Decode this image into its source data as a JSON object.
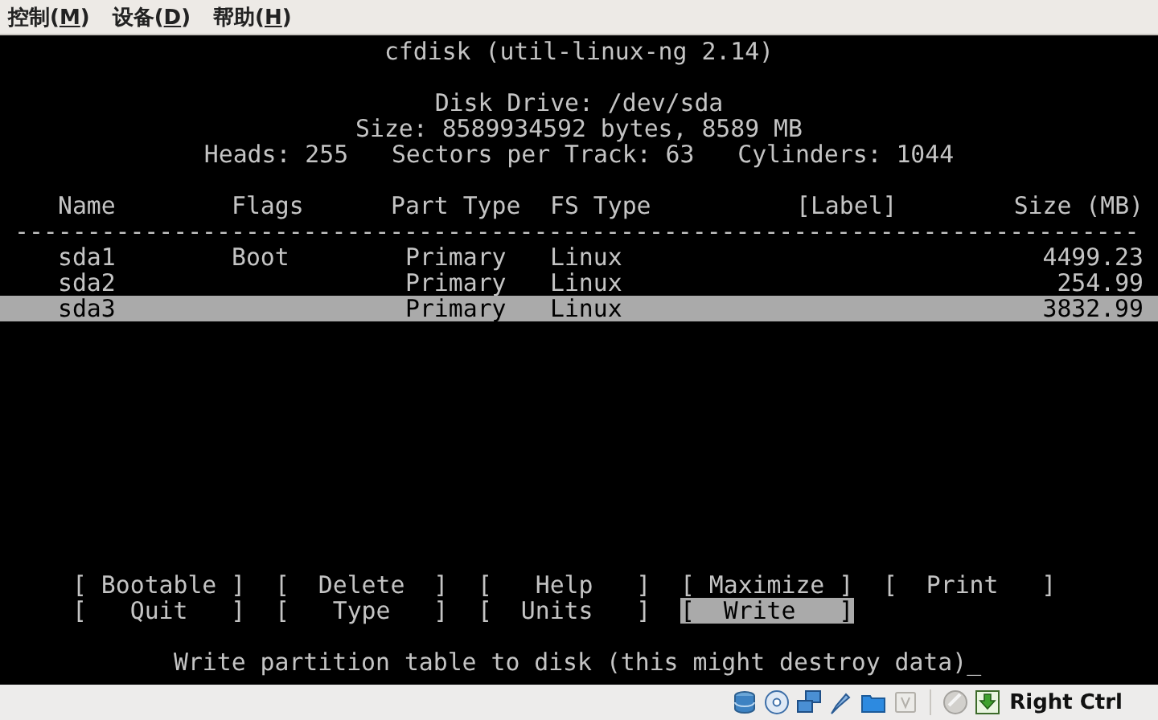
{
  "menu": [
    {
      "text": "控制(",
      "mnemonic": "M",
      "after": ")"
    },
    {
      "text": "设备(",
      "mnemonic": "D",
      "after": ")"
    },
    {
      "text": "帮助(",
      "mnemonic": "H",
      "after": ")"
    }
  ],
  "terminal": {
    "title": "cfdisk (util-linux-ng 2.14)",
    "disk_drive": "Disk Drive: /dev/sda",
    "size": "Size: 8589934592 bytes, 8589 MB",
    "geometry": "Heads: 255   Sectors per Track: 63   Cylinders: 1044",
    "table": {
      "columns": [
        "Name",
        "Flags",
        "Part Type",
        "FS Type",
        "[Label]",
        "Size (MB)"
      ],
      "rule": "------------------------------------------------------------------------------",
      "rows": [
        {
          "name": "sda1",
          "flags": "Boot",
          "part_type": "Primary",
          "fs_type": "Linux",
          "size": "4499.23",
          "selected": false
        },
        {
          "name": "sda2",
          "part_type": "Primary",
          "fs_type": "Linux",
          "size": "254.99",
          "selected": false
        },
        {
          "name": "sda3",
          "part_type": "Primary",
          "fs_type": "Linux",
          "size": "3832.99",
          "selected": true
        }
      ]
    },
    "commands": [
      {
        "label": "[ Bootable ]",
        "selected": false
      },
      {
        "label": "[  Delete  ]",
        "selected": false
      },
      {
        "label": "[   Help   ]",
        "selected": false
      },
      {
        "label": "[ Maximize ]",
        "selected": false
      },
      {
        "label": "[  Print   ]",
        "selected": false
      },
      {
        "label": "[   Quit   ]",
        "selected": false
      },
      {
        "label": "[   Type   ]",
        "selected": false
      },
      {
        "label": "[  Units   ]",
        "selected": false
      },
      {
        "label": "[  Write   ]",
        "selected": true
      }
    ],
    "message": "Write partition table to disk (this might destroy data)",
    "cursor": "_"
  },
  "status_bar": {
    "host_key": "Right Ctrl"
  }
}
